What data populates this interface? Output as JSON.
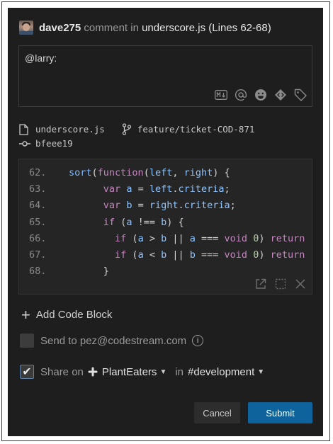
{
  "header": {
    "author": "dave275",
    "verb": "comment in",
    "file_ref": "underscore.js (Lines 62-68)"
  },
  "comment": {
    "value": "@larry:",
    "toolbar_icons": [
      "markdown-icon",
      "at-mention-icon",
      "emoji-icon",
      "codemark-icon",
      "tag-icon"
    ]
  },
  "code_meta": {
    "file": "underscore.js",
    "branch": "feature/ticket-COD-871",
    "commit": "bfeee19"
  },
  "code": {
    "lines": [
      {
        "num": "62.",
        "text": "sort(function(left, right) {"
      },
      {
        "num": "63.",
        "text": "var a = left.criteria;"
      },
      {
        "num": "64.",
        "text": "var b = right.criteria;"
      },
      {
        "num": "65.",
        "text": "if (a !== b) {"
      },
      {
        "num": "66.",
        "text": "if (a > b || a === void 0) return"
      },
      {
        "num": "67.",
        "text": "if (a < b || b === void 0) return"
      },
      {
        "num": "68.",
        "text": "}"
      }
    ]
  },
  "actions": {
    "add_code_block": "Add Code Block"
  },
  "send": {
    "label": "Send to pez@codestream.com",
    "checked": false
  },
  "share": {
    "prefix": "Share on",
    "workspace": "PlantEaters",
    "in_label": "in",
    "channel": "#development",
    "checked": true,
    "checkmark": "✔"
  },
  "buttons": {
    "cancel": "Cancel",
    "submit": "Submit"
  },
  "colors": {
    "background": "#1e1e1e",
    "accent": "#0e639c"
  }
}
